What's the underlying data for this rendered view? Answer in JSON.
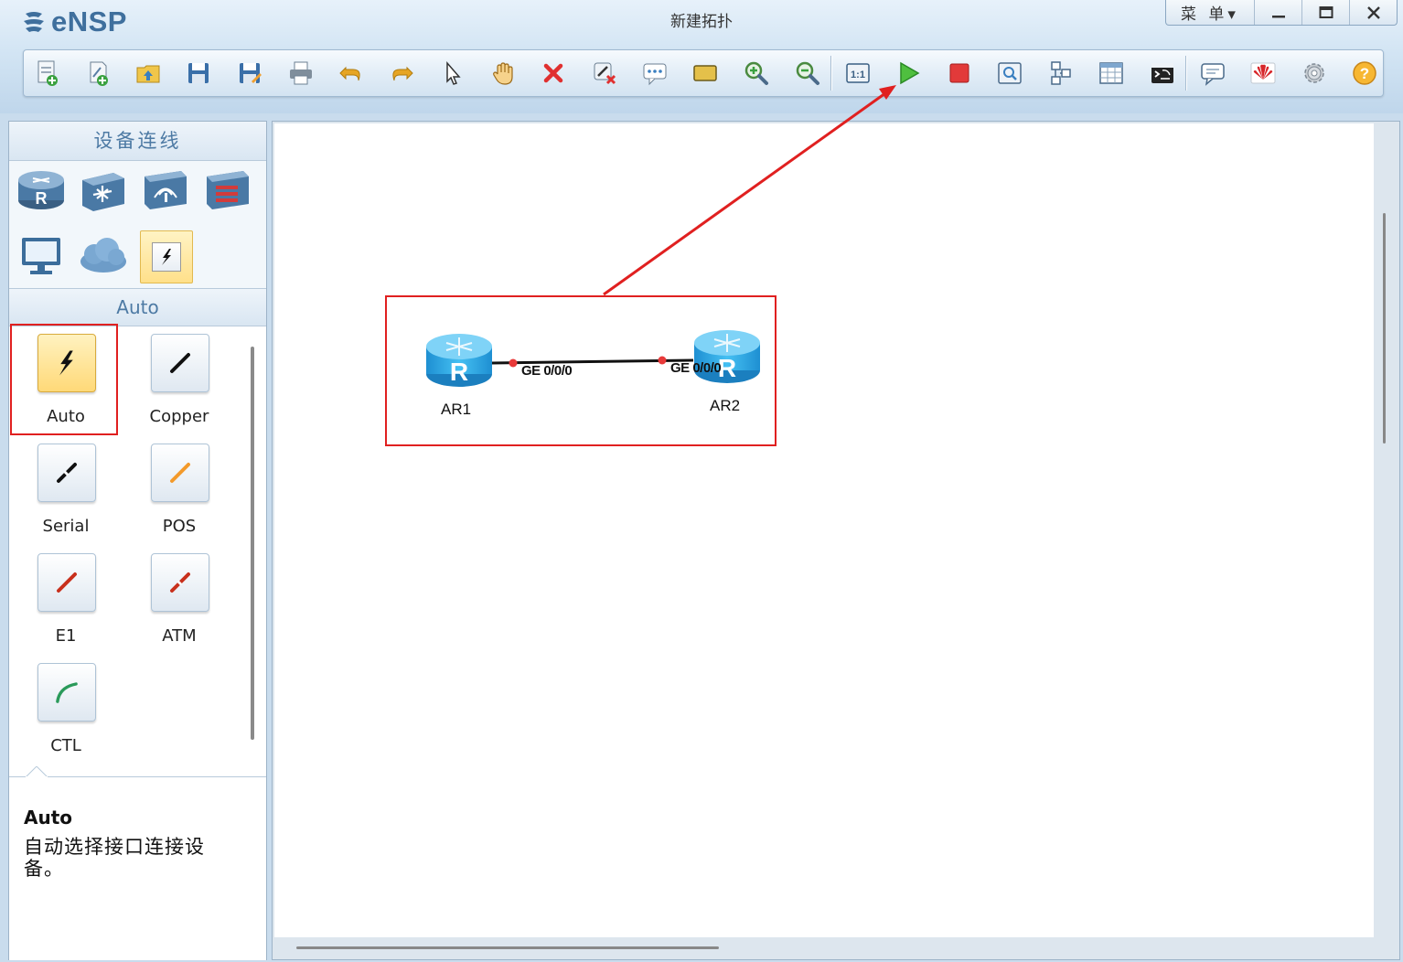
{
  "app": {
    "logo_text": "eNSP",
    "window_title": "新建拓扑"
  },
  "window_controls": {
    "menu_label": "菜 单▾",
    "minimize": "—",
    "maximize": "☐",
    "close": "✕"
  },
  "toolbar": {
    "items": [
      {
        "name": "new-topology-icon"
      },
      {
        "name": "new-example-icon"
      },
      {
        "name": "open-topology-icon"
      },
      {
        "name": "save-icon"
      },
      {
        "name": "save-as-icon"
      },
      {
        "name": "print-icon"
      },
      {
        "name": "undo-icon"
      },
      {
        "name": "redo-icon"
      },
      {
        "name": "select-pointer-icon"
      },
      {
        "name": "pan-hand-icon"
      },
      {
        "name": "delete-icon"
      },
      {
        "name": "delete-link-icon"
      },
      {
        "name": "text-comment-icon"
      },
      {
        "name": "rectangle-icon"
      },
      {
        "name": "zoom-in-icon"
      },
      {
        "name": "zoom-out-icon"
      },
      {
        "name": "actual-size-icon"
      },
      {
        "name": "start-device-icon"
      },
      {
        "name": "stop-device-icon"
      },
      {
        "name": "capture-icon"
      },
      {
        "name": "topology-icon"
      },
      {
        "name": "grid-icon"
      },
      {
        "name": "command-line-icon"
      },
      {
        "name": "chat-icon"
      },
      {
        "name": "huawei-logo-icon"
      },
      {
        "name": "settings-gear-icon"
      },
      {
        "name": "help-icon"
      }
    ]
  },
  "sidebar": {
    "section_title": "设备连线",
    "devices": [
      {
        "name": "router-category"
      },
      {
        "name": "switch-category"
      },
      {
        "name": "wlan-category"
      },
      {
        "name": "firewall-category"
      },
      {
        "name": "pc-category"
      },
      {
        "name": "cloud-category"
      },
      {
        "name": "connection-category"
      }
    ],
    "sub_title": "Auto",
    "links": [
      {
        "label": "Auto",
        "icon": "auto-link-icon",
        "color": "#111111"
      },
      {
        "label": "Copper",
        "icon": "copper-link-icon",
        "color": "#111111"
      },
      {
        "label": "Serial",
        "icon": "serial-link-icon",
        "color": "#111111"
      },
      {
        "label": "POS",
        "icon": "pos-link-icon",
        "color": "#f39a2b"
      },
      {
        "label": "E1",
        "icon": "e1-link-icon",
        "color": "#c8301c"
      },
      {
        "label": "ATM",
        "icon": "atm-link-icon",
        "color": "#c8301c"
      },
      {
        "label": "CTL",
        "icon": "ctl-link-icon",
        "color": "#2a9a5a"
      }
    ],
    "description": {
      "title": "Auto",
      "text": "自动选择接口连接设备。"
    }
  },
  "topology": {
    "nodes": [
      {
        "label": "AR1"
      },
      {
        "label": "AR2"
      }
    ],
    "link": {
      "port_a": "GE 0/0/0",
      "port_b": "GE 0/0/0",
      "endpoint_color": "#e83a3a"
    }
  },
  "colors": {
    "annotation_red": "#e02020",
    "router_blue": "#2aa6e6",
    "start_green": "#37a83a"
  }
}
